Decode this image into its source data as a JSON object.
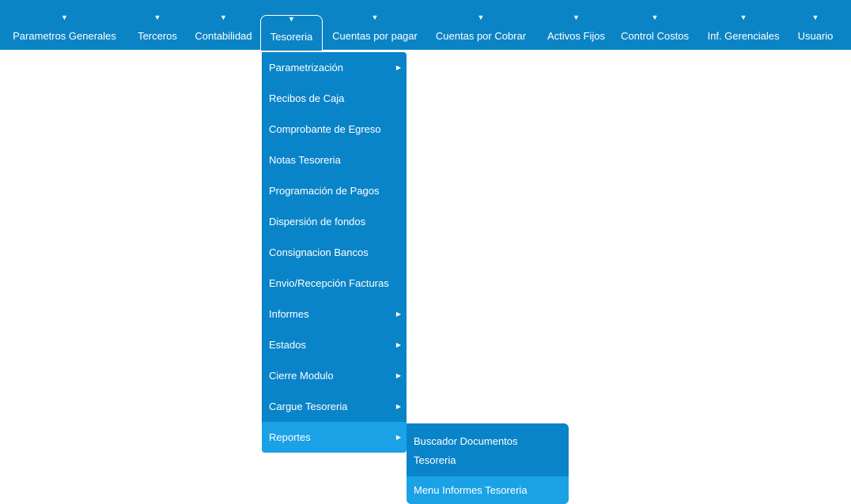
{
  "nav": {
    "items": [
      {
        "label": "Parametros Generales",
        "arrow": "▼"
      },
      {
        "label": "Terceros",
        "arrow": "▼"
      },
      {
        "label": "Contabilidad",
        "arrow": "▼"
      },
      {
        "label": "Tesoreria",
        "arrow": "▼"
      },
      {
        "label": "Cuentas por pagar",
        "arrow": "▼"
      },
      {
        "label": "Cuentas por Cobrar",
        "arrow": "▼"
      },
      {
        "label": "Activos Fijos",
        "arrow": "▼"
      },
      {
        "label": "Control Costos",
        "arrow": "▼"
      },
      {
        "label": "Inf. Gerenciales",
        "arrow": "▼"
      },
      {
        "label": "Usuario",
        "arrow": "▼"
      }
    ]
  },
  "menu": {
    "caret": "▶",
    "items": [
      {
        "label": "Parametrización"
      },
      {
        "label": "Recibos de Caja"
      },
      {
        "label": "Comprobante de Egreso"
      },
      {
        "label": "Notas Tesoreria"
      },
      {
        "label": "Programación de Pagos"
      },
      {
        "label": "Dispersión de fondos"
      },
      {
        "label": "Consignacion Bancos"
      },
      {
        "label": "Envio/Recepción Facturas"
      },
      {
        "label": "Informes"
      },
      {
        "label": "Estados"
      },
      {
        "label": "Cierre Modulo"
      },
      {
        "label": "Cargue Tesoreria"
      },
      {
        "label": "Reportes"
      }
    ]
  },
  "submenu": {
    "items": [
      {
        "label": "Buscador Documentos Tesoreria"
      },
      {
        "label": "Menu Informes Tesoreria"
      }
    ]
  },
  "colors": {
    "bar": "#0b84c6",
    "menu": "#0a84c8",
    "highlight": "#1ba2e6",
    "text": "#ffffff"
  }
}
